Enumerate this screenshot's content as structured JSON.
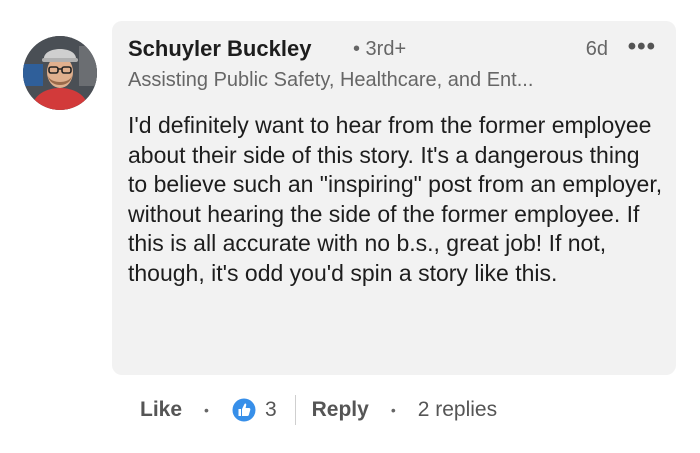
{
  "comment": {
    "author_name": "Schuyler Buckley",
    "degree": "• 3rd+",
    "time": "6d",
    "more_label": "•••",
    "headline": "Assisting Public Safety, Healthcare, and Ent...",
    "text": "I'd definitely want to hear from the former employee about their side of this story. It's a dangerous thing to believe such an \"inspiring\" post from an employer, without hearing the side of the former employee. If this is all accurate with no b.s., great job! If not, though, it's odd you'd spin a story like this."
  },
  "actions": {
    "like_label": "Like",
    "separator": "•",
    "reaction_count": "3",
    "reply_label": "Reply",
    "replies_label": "2 replies"
  },
  "colors": {
    "bubble": "#f2f2f2",
    "like_icon": "#378fe9",
    "muted_text": "#666666"
  }
}
